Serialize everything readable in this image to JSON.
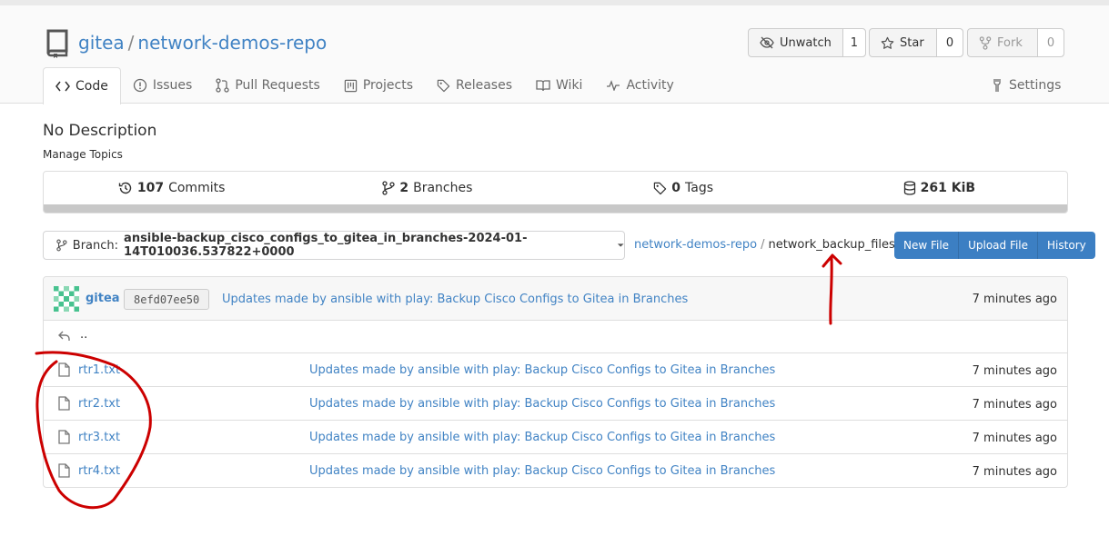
{
  "repo": {
    "owner": "gitea",
    "separator": "/",
    "name": "network-demos-repo"
  },
  "buttons": {
    "unwatch": {
      "label": "Unwatch",
      "count": "1"
    },
    "star": {
      "label": "Star",
      "count": "0"
    },
    "fork": {
      "label": "Fork",
      "count": "0"
    }
  },
  "tabs": [
    {
      "label": "Code",
      "icon": "code-icon"
    },
    {
      "label": "Issues",
      "icon": "issue-icon"
    },
    {
      "label": "Pull Requests",
      "icon": "pull-request-icon"
    },
    {
      "label": "Projects",
      "icon": "project-icon"
    },
    {
      "label": "Releases",
      "icon": "tag-icon"
    },
    {
      "label": "Wiki",
      "icon": "book-icon"
    },
    {
      "label": "Activity",
      "icon": "pulse-icon"
    }
  ],
  "settings_label": "Settings",
  "description": "No Description",
  "manage_topics": "Manage Topics",
  "stats": {
    "commits": {
      "num": "107",
      "label": "Commits"
    },
    "branches": {
      "num": "2",
      "label": "Branches"
    },
    "tags": {
      "num": "0",
      "label": "Tags"
    },
    "size": "261 KiB"
  },
  "branch": {
    "prefix": "Branch:",
    "name": "ansible-backup_cisco_configs_to_gitea_in_branches-2024-01-14T010036.537822+0000"
  },
  "breadcrumb": {
    "repo": "network-demos-repo",
    "divider": "/",
    "folder": "network_backup_files"
  },
  "actions": {
    "new_file": "New File",
    "upload_file": "Upload File",
    "history": "History"
  },
  "latest_commit": {
    "user": "gitea",
    "sha": "8efd07ee50",
    "message": "Updates made by ansible with play: Backup Cisco Configs to Gitea in Branches",
    "time": "7 minutes ago"
  },
  "parent_dir": "..",
  "files": [
    {
      "name": "rtr1.txt",
      "message": "Updates made by ansible with play: Backup Cisco Configs to Gitea in Branches",
      "time": "7 minutes ago"
    },
    {
      "name": "rtr2.txt",
      "message": "Updates made by ansible with play: Backup Cisco Configs to Gitea in Branches",
      "time": "7 minutes ago"
    },
    {
      "name": "rtr3.txt",
      "message": "Updates made by ansible with play: Backup Cisco Configs to Gitea in Branches",
      "time": "7 minutes ago"
    },
    {
      "name": "rtr4.txt",
      "message": "Updates made by ansible with play: Backup Cisco Configs to Gitea in Branches",
      "time": "7 minutes ago"
    }
  ],
  "colors": {
    "link": "#4183c4",
    "primary_button": "#3c7fc3",
    "annotation": "#cc0000"
  }
}
